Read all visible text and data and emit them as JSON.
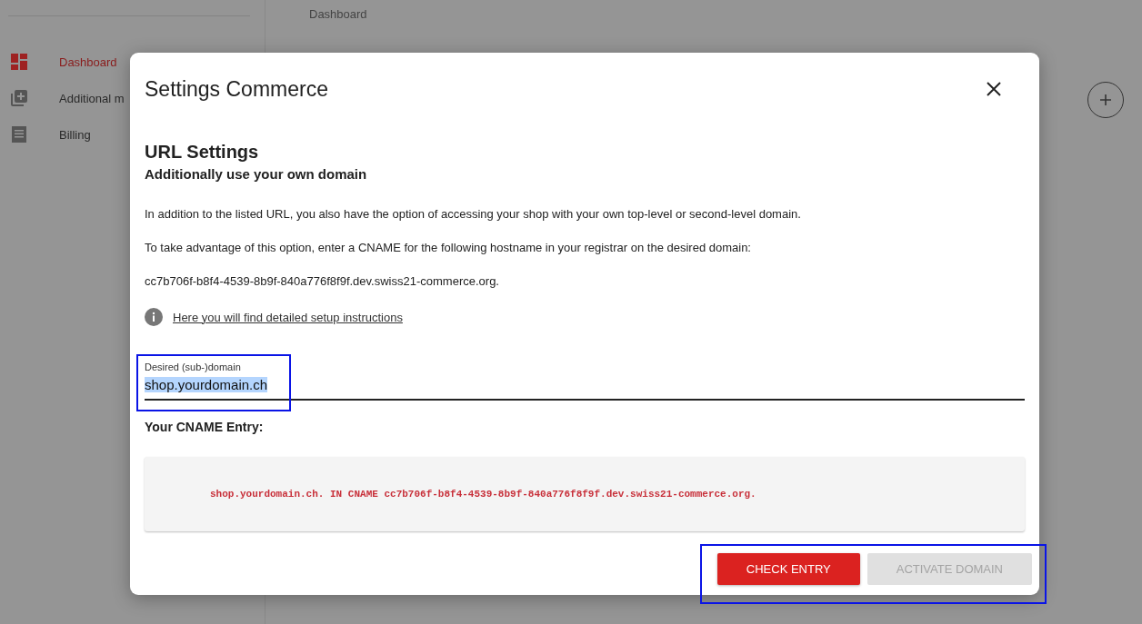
{
  "sidebar": {
    "items": [
      {
        "label": "Dashboard",
        "selected": true
      },
      {
        "label": "Additional m",
        "selected": false
      },
      {
        "label": "Billing",
        "selected": false
      }
    ]
  },
  "page": {
    "breadcrumb": "Dashboard"
  },
  "dialog": {
    "title": "Settings Commerce",
    "heading": "URL Settings",
    "subheading": "Additionally use your own domain",
    "paragraphs": [
      "In addition to the listed URL, you also have the option of accessing your shop with your own top-level or second-level domain.",
      "To take advantage of this option, enter a CNAME for the following hostname in your registrar on the desired domain:",
      "cc7b706f-b8f4-4539-8b9f-840a776f8f9f.dev.swiss21-commerce.org."
    ],
    "info_link": "Here you will find detailed setup instructions",
    "field": {
      "label": "Desired (sub-)domain",
      "value": "shop.yourdomain.ch",
      "value_selected": true
    },
    "cname_label": "Your CNAME Entry:",
    "cname_entry": "shop.yourdomain.ch. IN CNAME cc7b706f-b8f4-4539-8b9f-840a776f8f9f.dev.swiss21-commerce.org.",
    "buttons": [
      {
        "label": "CHECK ENTRY",
        "disabled": false
      },
      {
        "label": "ACTIVATE DOMAIN",
        "disabled": true
      }
    ]
  }
}
